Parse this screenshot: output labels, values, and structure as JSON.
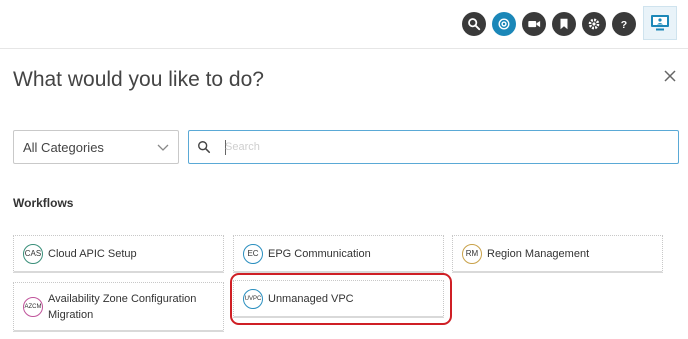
{
  "toolbar": {
    "icons": [
      "search-icon",
      "activity-icon",
      "video-icon",
      "bookmark-icon",
      "gear-icon",
      "help-icon",
      "user-monitor-icon"
    ],
    "accent_color": "#1b87b8"
  },
  "dialog": {
    "title": "What would you like to do?",
    "close_icon": "close-icon"
  },
  "filters": {
    "category_selected": "All Categories",
    "search_placeholder": "Search"
  },
  "workflows": {
    "heading": "Workflows",
    "items": [
      {
        "abbr": "CAS",
        "label": "Cloud APIC Setup",
        "badge_color": "#3a8f7a"
      },
      {
        "abbr": "EC",
        "label": "EPG Communication",
        "badge_color": "#2b8fbf"
      },
      {
        "abbr": "RM",
        "label": "Region Management",
        "badge_color": "#c9a24a"
      },
      {
        "abbr": "AZCM",
        "label": "Availability Zone Configuration Migration",
        "badge_color": "#c0549b"
      },
      {
        "abbr": "UVPC",
        "label": "Unmanaged VPC",
        "badge_color": "#2b8fbf"
      }
    ],
    "highlight_color": "#cf1f25"
  }
}
